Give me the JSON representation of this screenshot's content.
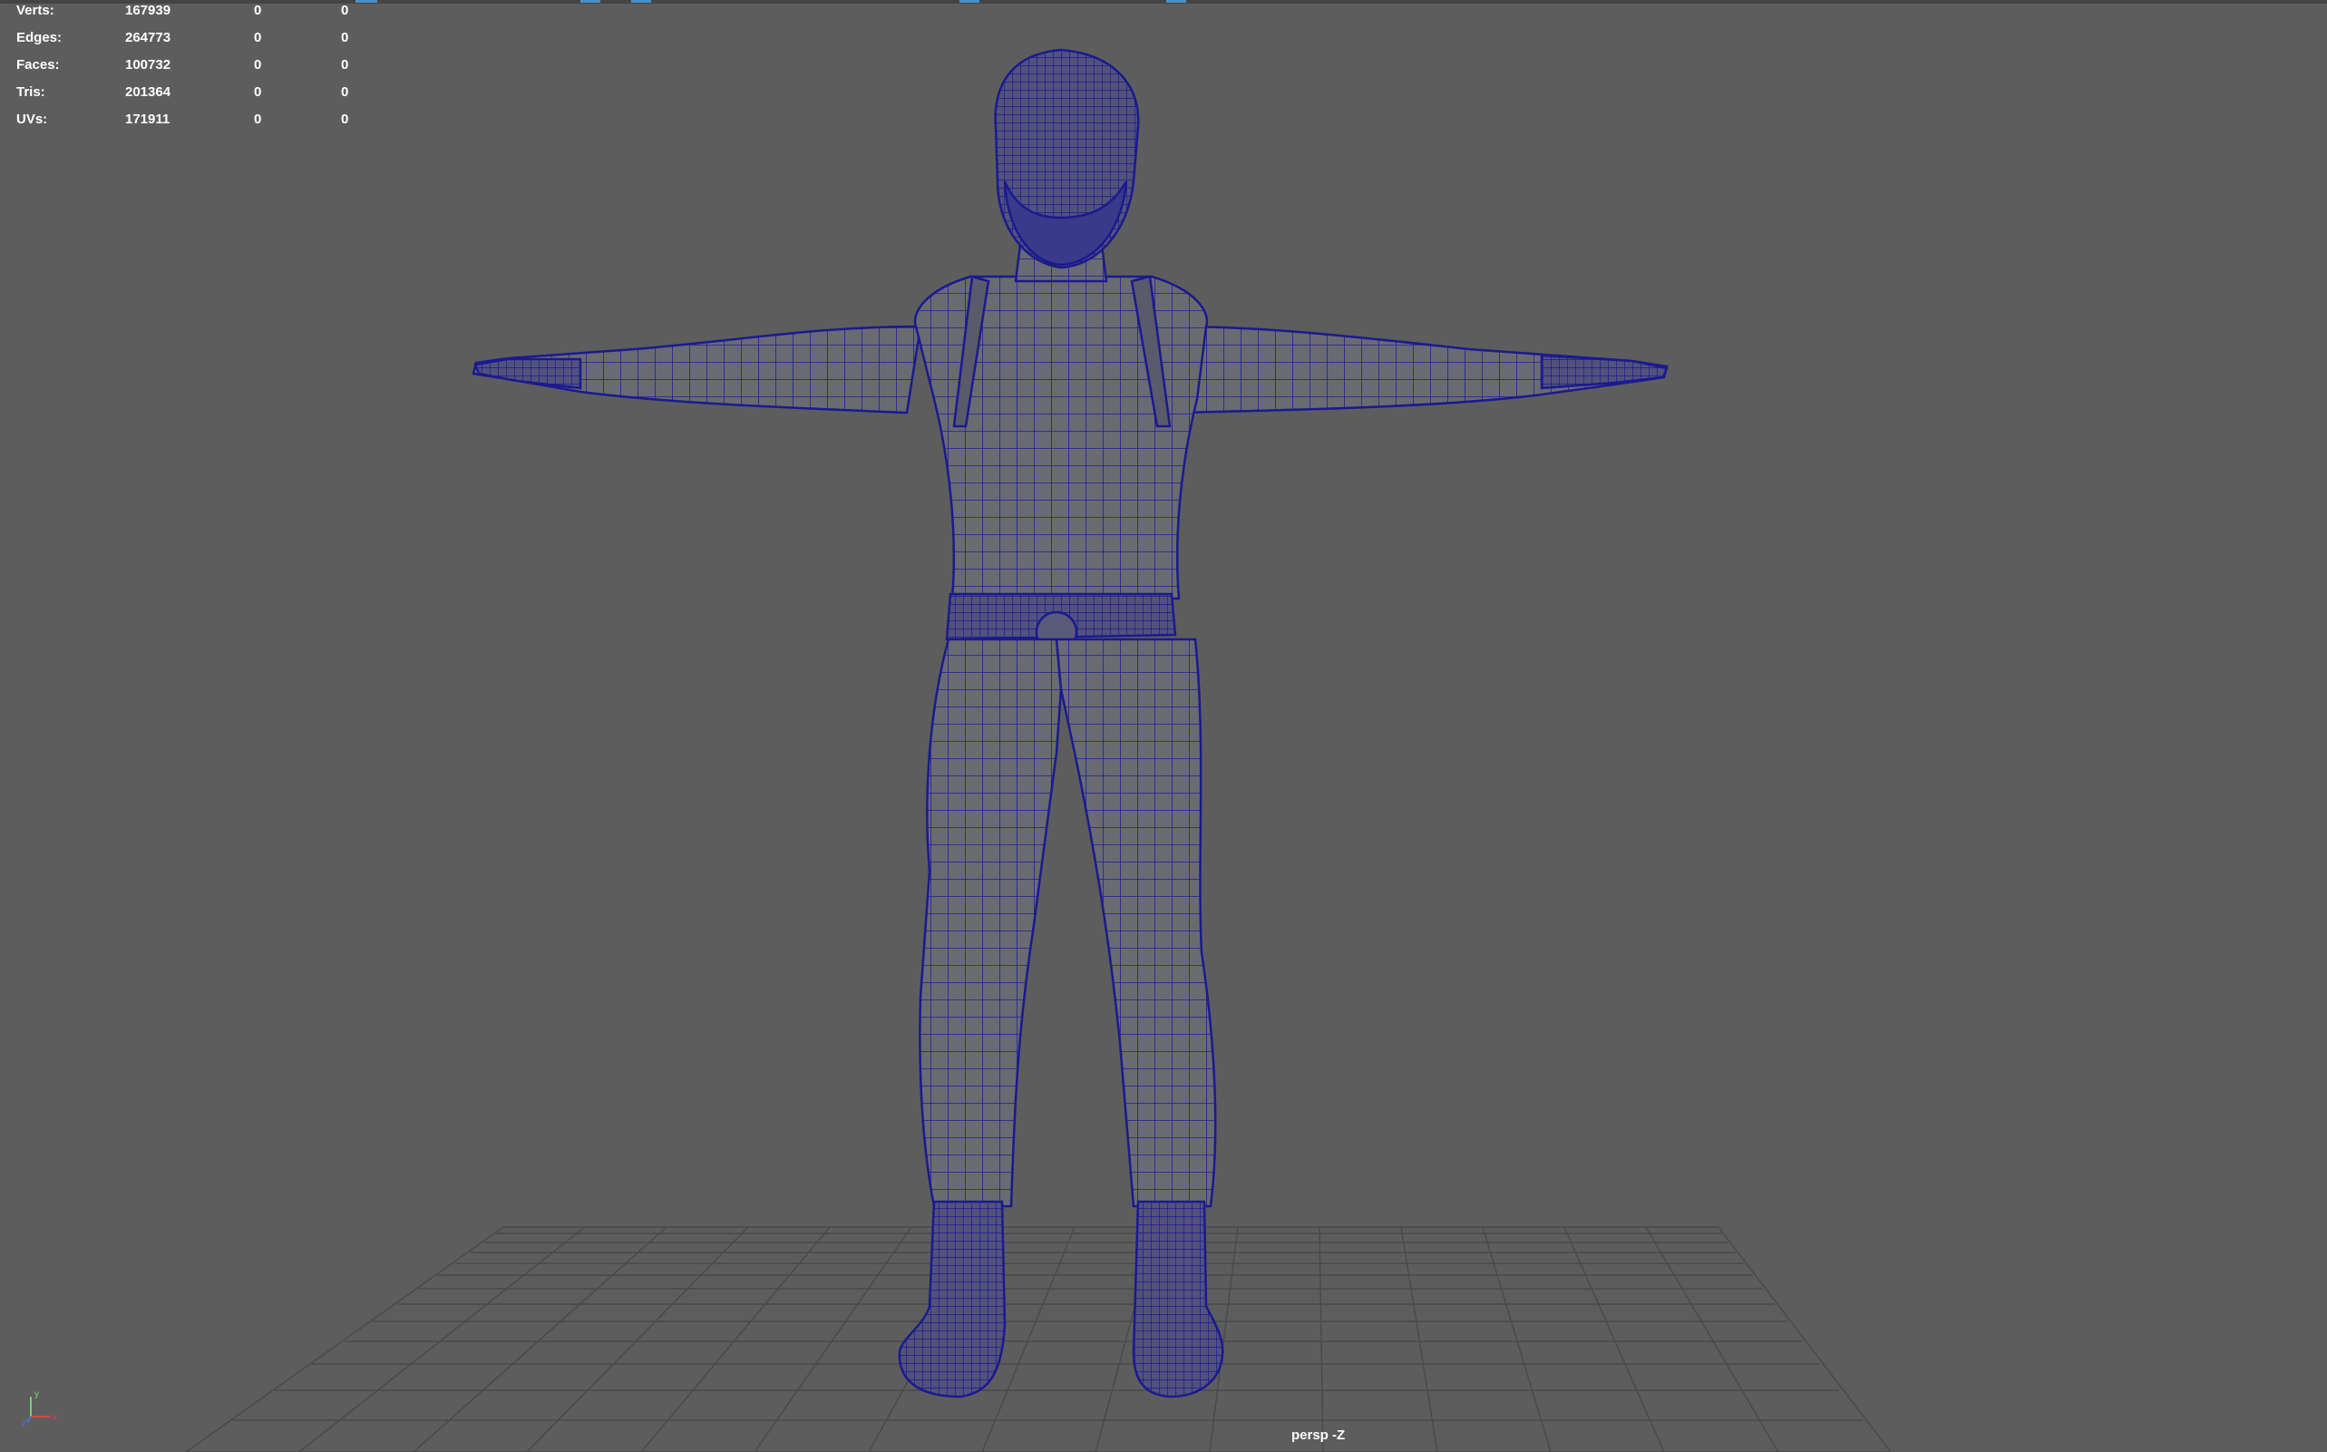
{
  "app": "Autodesk Maya viewport",
  "heads_up_display": {
    "rows": [
      {
        "label": "Verts:",
        "total": "167939",
        "selected": "0",
        "component": "0"
      },
      {
        "label": "Edges:",
        "total": "264773",
        "selected": "0",
        "component": "0"
      },
      {
        "label": "Faces:",
        "total": "100732",
        "selected": "0",
        "component": "0"
      },
      {
        "label": "Tris:",
        "total": "201364",
        "selected": "0",
        "component": "0"
      },
      {
        "label": "UVs:",
        "total": "171911",
        "selected": "0",
        "component": "0"
      }
    ]
  },
  "camera_label": "persp -Z",
  "axis_indicator": {
    "labels": [
      "y",
      "x",
      "z"
    ]
  },
  "colors": {
    "viewport_bg": "#5d5d5d",
    "wireframe": "#1e1e9a",
    "mesh_fill": "#6a6a70",
    "grid": "#4a4a4a"
  },
  "model": {
    "icon": "character-wireframe",
    "pose": "T-pose"
  }
}
